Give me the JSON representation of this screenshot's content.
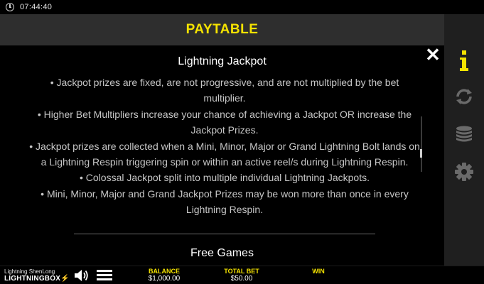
{
  "status_bar": {
    "time": "07:44:40"
  },
  "header": {
    "title": "PAYTABLE"
  },
  "content": {
    "section_title": "Lightning Jackpot",
    "bullets": [
      "• Jackpot prizes are fixed, are not progressive, and are not multiplied by the bet multiplier.",
      "• Higher Bet Multipliers increase your chance of achieving a Jackpot OR increase the Jackpot Prizes.",
      "• Jackpot prizes are collected when a Mini, Minor, Major or Grand Lightning Bolt lands on a Lightning Respin triggering spin or within an active reel/s during Lightning Respin.",
      "• Colossal Jackpot split into multiple individual Lightning Jackpots.",
      "• Mini, Minor, Major and Grand Jackpot Prizes may be won more than once in every Lightning Respin."
    ],
    "next_section_title": "Free Games",
    "close_symbol": "✕"
  },
  "side_menu": {
    "active_color": "#f5e300",
    "inactive_color": "#6a6a6a",
    "items": [
      {
        "icon": "info-icon",
        "active": true
      },
      {
        "icon": "autoplay-icon",
        "active": false
      },
      {
        "icon": "bet-coins-icon",
        "active": false
      },
      {
        "icon": "settings-gear-icon",
        "active": false
      }
    ]
  },
  "bottom_bar": {
    "logo_line1": "Lightning ShenLong",
    "logo_line2": "LIGHTNING",
    "logo_line3": "BOX",
    "balance_label": "BALANCE",
    "balance_value": "$1,000.00",
    "total_bet_label": "TOTAL BET",
    "total_bet_value": "$50.00",
    "win_label": "WIN",
    "win_value": ""
  },
  "colors": {
    "accent": "#f5e300",
    "header_bg": "#2e2e2e",
    "side_bg": "#1f1f1f"
  }
}
